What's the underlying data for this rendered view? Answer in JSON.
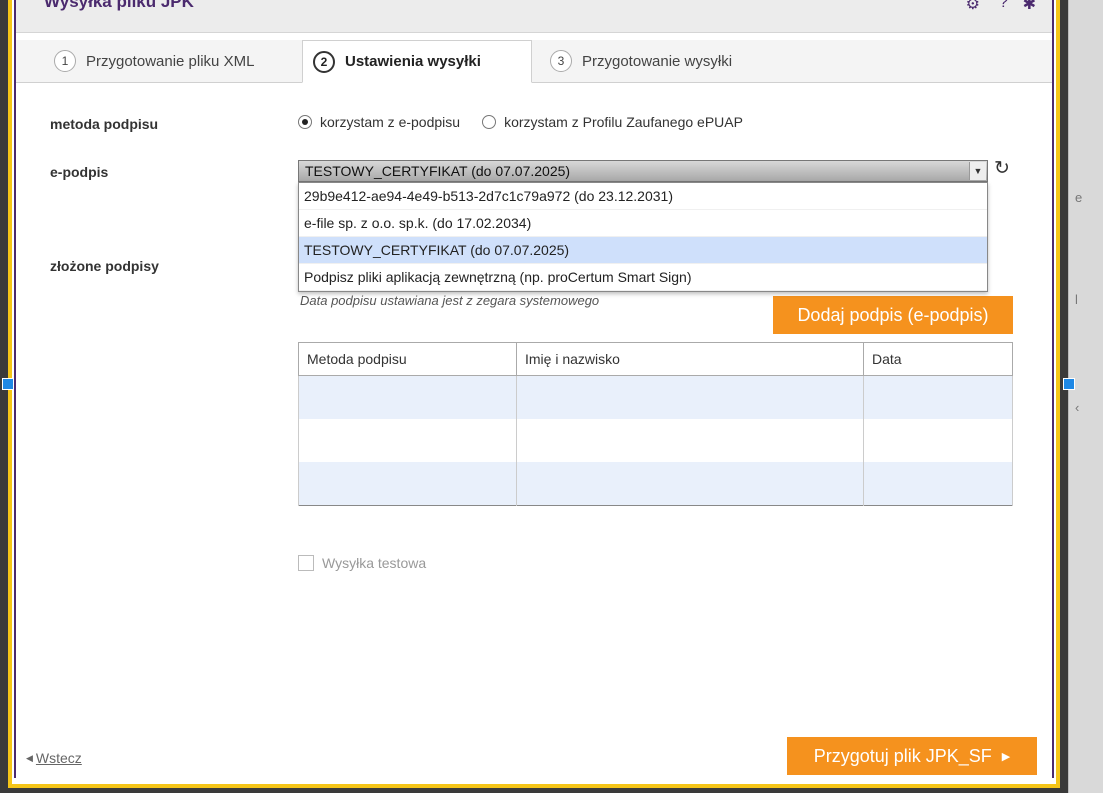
{
  "window": {
    "title": "Wysyłka pliku JPK"
  },
  "tabs": [
    {
      "num": "1",
      "label": "Przygotowanie pliku XML",
      "active": false
    },
    {
      "num": "2",
      "label": "Ustawienia wysyłki",
      "active": true
    },
    {
      "num": "3",
      "label": "Przygotowanie wysyłki",
      "active": false
    }
  ],
  "signature_method": {
    "label": "metoda podpisu",
    "options": [
      {
        "label": "korzystam z e-podpisu",
        "selected": true
      },
      {
        "label": "korzystam z Profilu Zaufanego ePUAP",
        "selected": false
      }
    ]
  },
  "epodpis": {
    "label": "e-podpis",
    "selected": "TESTOWY_CERTYFIKAT (do 07.07.2025)",
    "options": [
      "29b9e412-ae94-4e49-b513-2d7c1c79a972 (do 23.12.2031)",
      "e-file sp. z o.o. sp.k. (do 17.02.2034)",
      "TESTOWY_CERTYFIKAT (do 07.07.2025)",
      "Podpisz pliki aplikacją zewnętrzną (np. proCertum Smart Sign)"
    ],
    "highlighted_index": 2
  },
  "signatures": {
    "label": "złożone podpisy",
    "hint": "Data podpisu ustawiana jest z zegara systemowego",
    "add_button": "Dodaj podpis (e-podpis)",
    "columns": [
      "Metoda podpisu",
      "Imię i nazwisko",
      "Data"
    ]
  },
  "test_send": {
    "label": "Wysyłka testowa",
    "checked": false
  },
  "footer": {
    "back": "Wstecz",
    "next": "Przygotuj plik JPK_SF"
  },
  "colors": {
    "accent": "#f5921e",
    "frame": "#f5c518",
    "brand": "#4b2a6e",
    "selection": "#cfe0fb"
  }
}
